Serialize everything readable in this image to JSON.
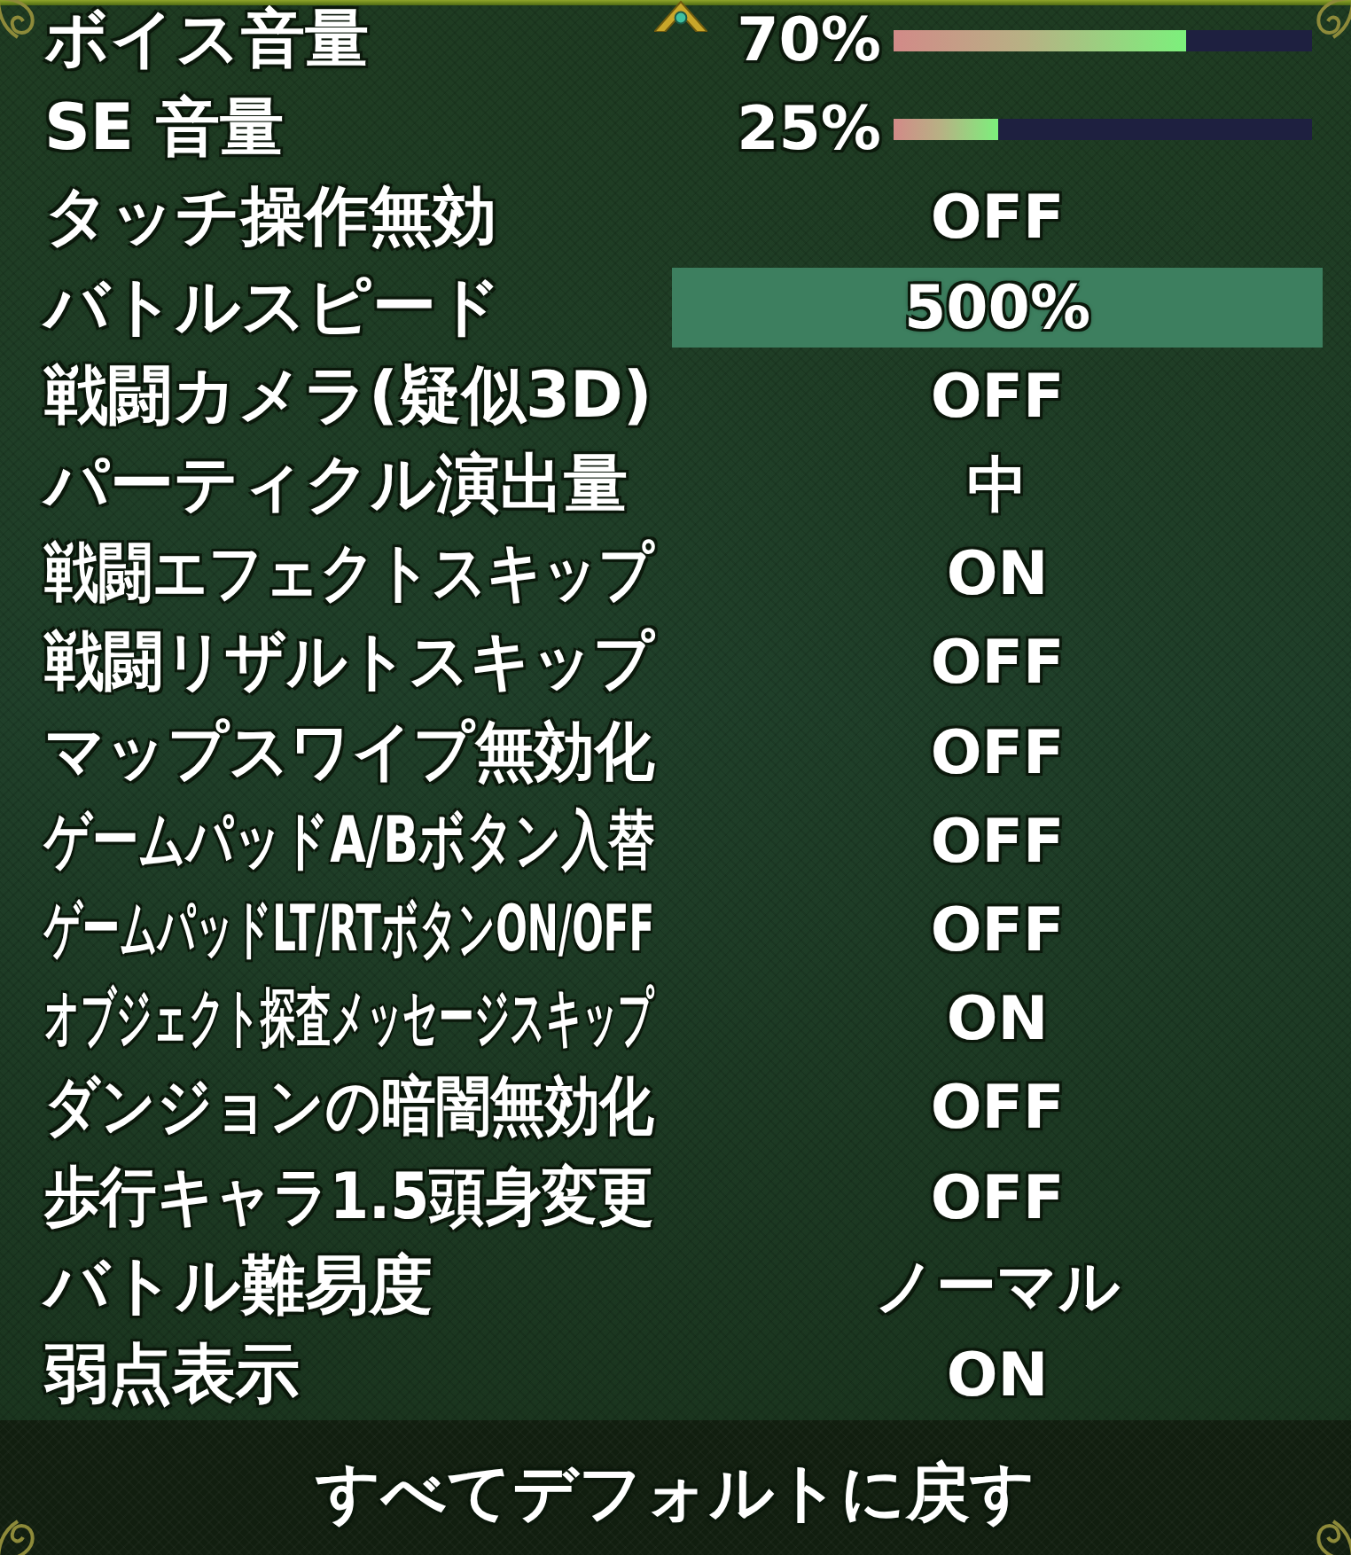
{
  "settings": [
    {
      "kind": "volume",
      "label": "ボイス音量",
      "value": "70%",
      "level": 0.7,
      "selected": false
    },
    {
      "kind": "volume",
      "label": "SE 音量",
      "value": "25%",
      "level": 0.25,
      "selected": false
    },
    {
      "kind": "option",
      "label": "タッチ操作無効",
      "value": "OFF",
      "selected": false
    },
    {
      "kind": "option",
      "label": "バトルスピード",
      "value": "500%",
      "selected": true
    },
    {
      "kind": "option",
      "label": "戦闘カメラ(疑似3D)",
      "value": "OFF",
      "selected": false
    },
    {
      "kind": "option",
      "label": "パーティクル演出量",
      "value": "中",
      "selected": false
    },
    {
      "kind": "option",
      "label": "戦闘エフェクトスキップ",
      "value": "ON",
      "selected": false
    },
    {
      "kind": "option",
      "label": "戦闘リザルトスキップ",
      "value": "OFF",
      "selected": false
    },
    {
      "kind": "option",
      "label": "マップスワイプ無効化",
      "value": "OFF",
      "selected": false
    },
    {
      "kind": "option",
      "label": "ゲームパッドA/Bボタン入替",
      "value": "OFF",
      "selected": false
    },
    {
      "kind": "option",
      "label": "ゲームパッドLT/RTボタンON/OFF",
      "value": "OFF",
      "selected": false
    },
    {
      "kind": "option",
      "label": "オブジェクト探査メッセージスキップ",
      "value": "ON",
      "selected": false
    },
    {
      "kind": "option",
      "label": "ダンジョンの暗闇無効化",
      "value": "OFF",
      "selected": false
    },
    {
      "kind": "option",
      "label": "歩行キャラ1.5頭身変更",
      "value": "OFF",
      "selected": false
    },
    {
      "kind": "option",
      "label": "バトル難易度",
      "value": "ノーマル",
      "selected": false
    },
    {
      "kind": "option",
      "label": "弱点表示",
      "value": "ON",
      "selected": false
    }
  ],
  "reset_button": {
    "label": "すべてデフォルトに戻す"
  }
}
